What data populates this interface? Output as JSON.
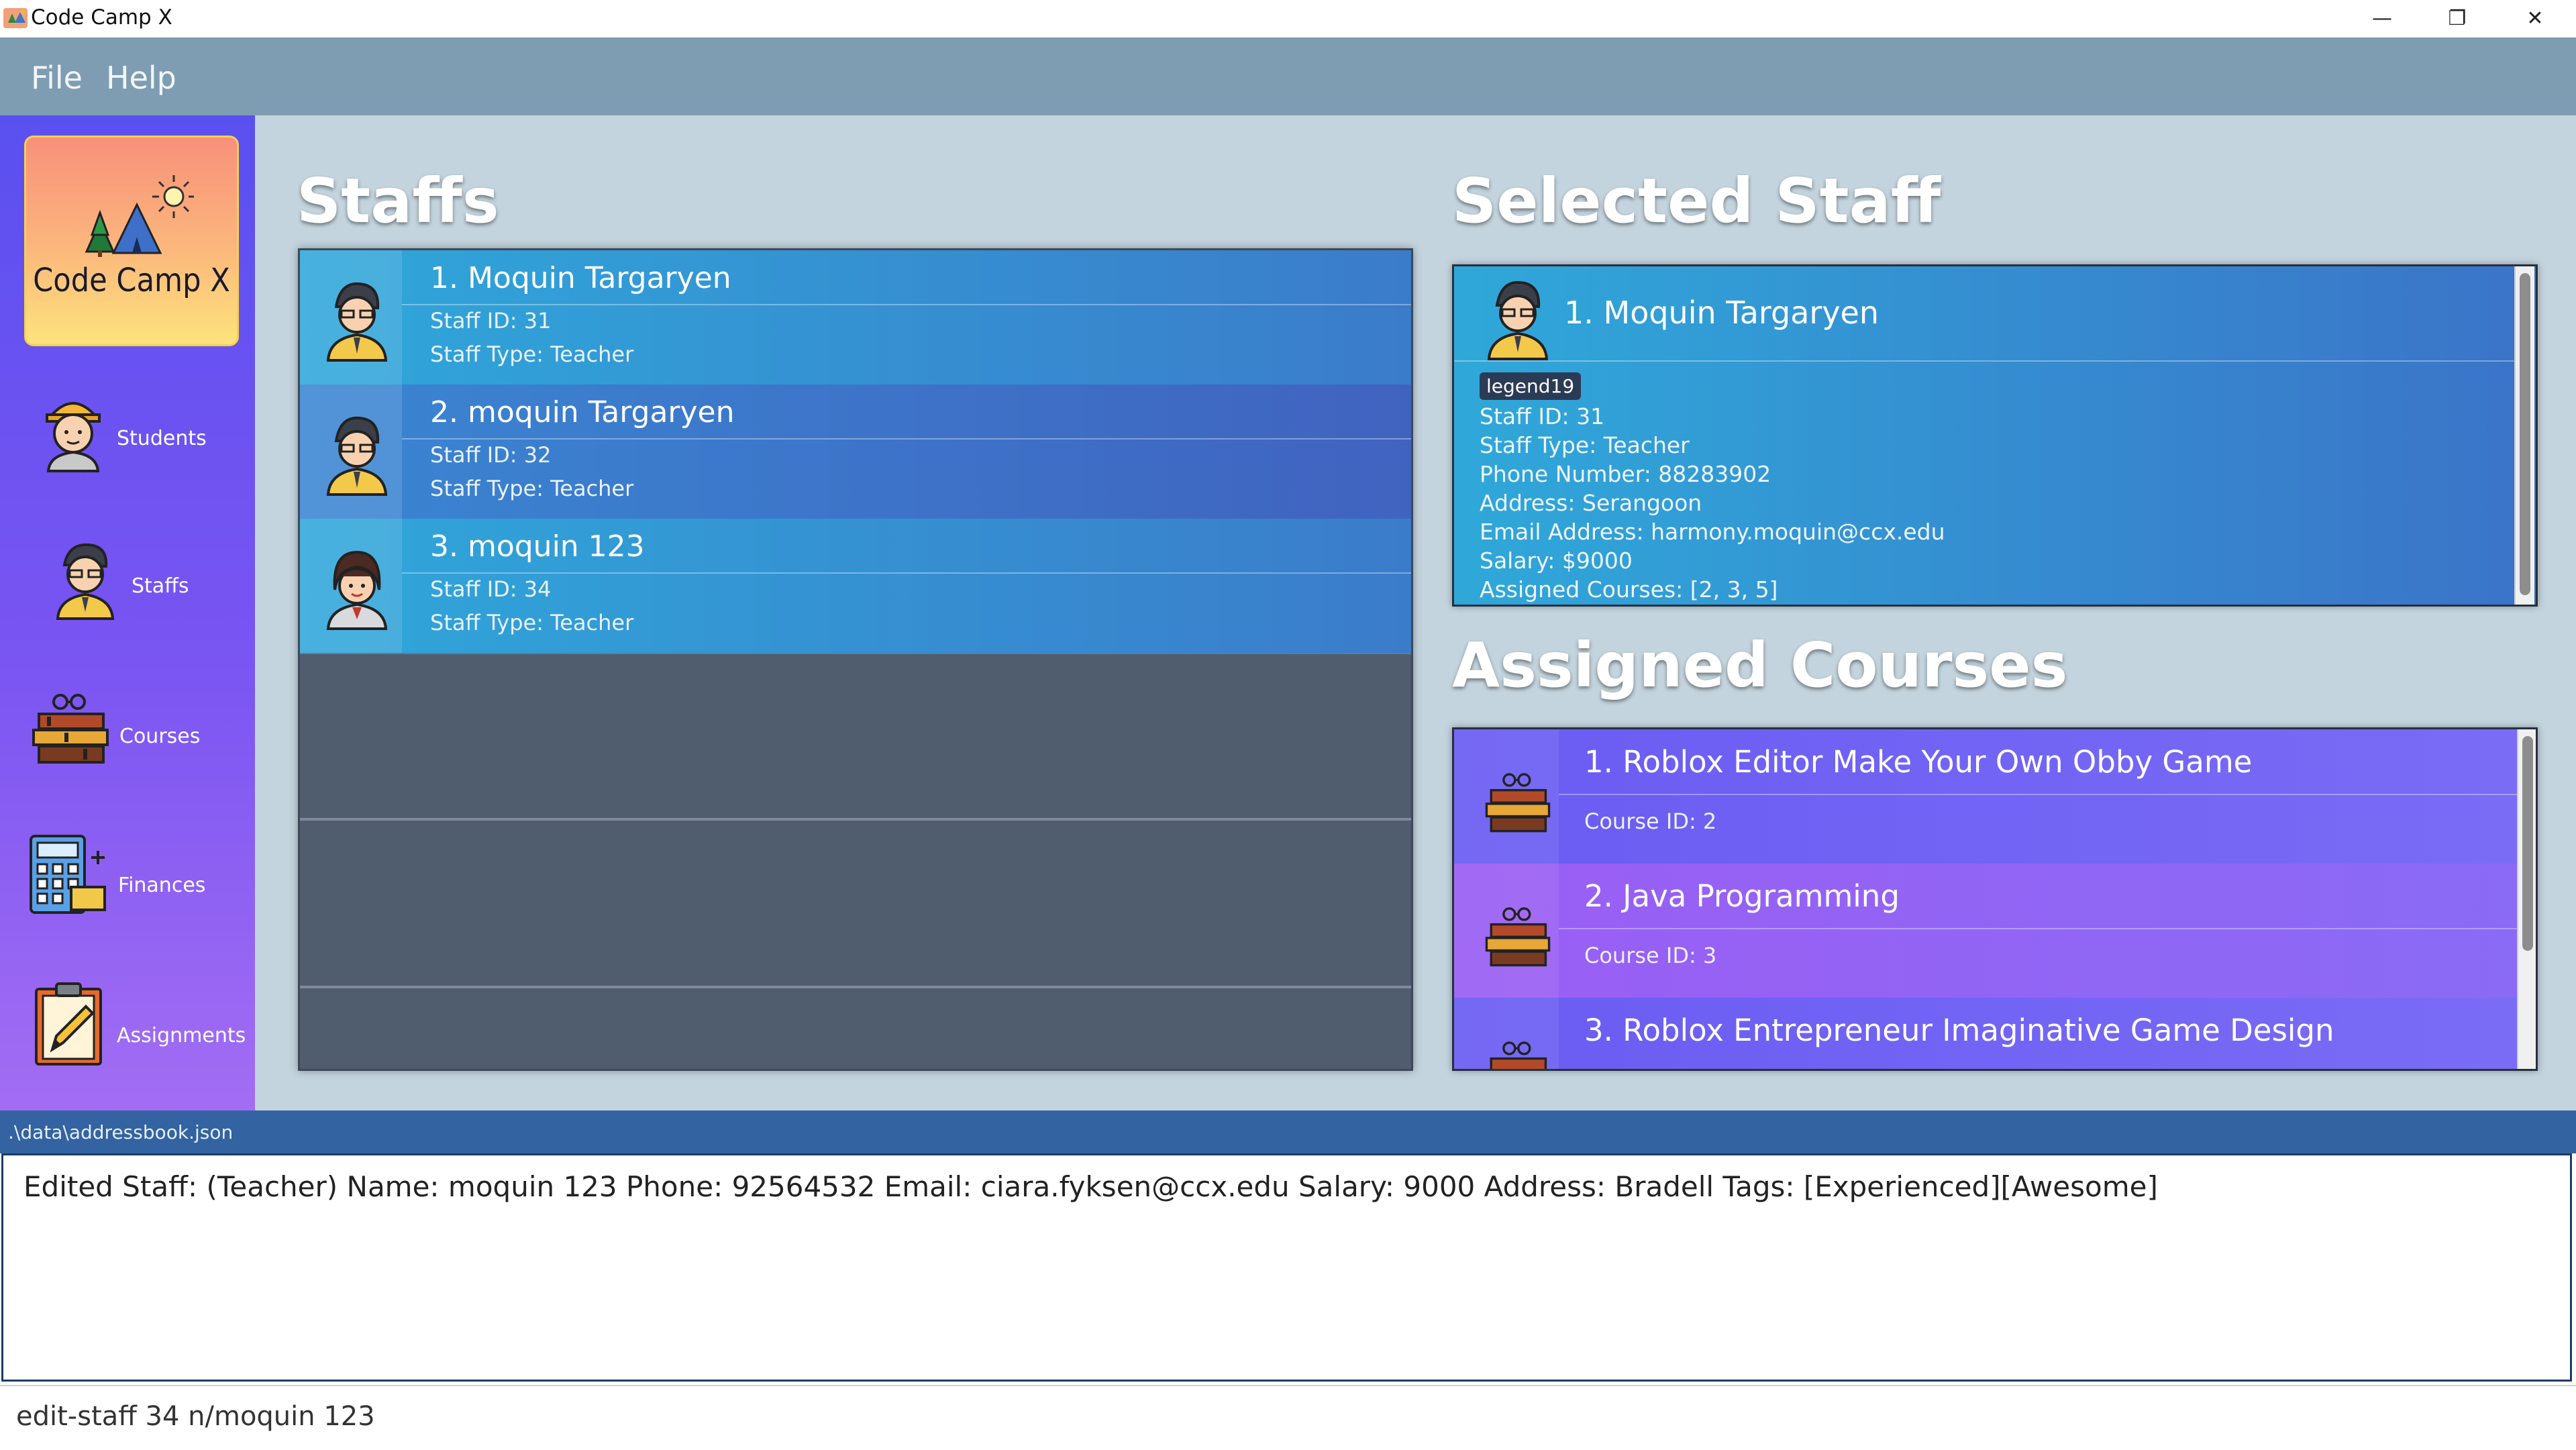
{
  "window": {
    "title": "Code Camp X",
    "controls": [
      "—",
      "❐",
      "✕"
    ]
  },
  "menu": {
    "items": [
      "File",
      "Help"
    ]
  },
  "sidebar": {
    "logo_text": "Code Camp X",
    "items": [
      {
        "label": "Students",
        "icon": "student-icon"
      },
      {
        "label": "Staffs",
        "icon": "staff-icon"
      },
      {
        "label": "Courses",
        "icon": "books-icon"
      },
      {
        "label": "Finances",
        "icon": "calculator-icon"
      },
      {
        "label": "Assignments",
        "icon": "clipboard-pencil-icon"
      }
    ]
  },
  "staffs": {
    "title": "Staffs",
    "items": [
      {
        "name": "1. Moquin Targaryen",
        "id": "Staff ID: 31",
        "type": "Staff Type: Teacher",
        "avatar": "male"
      },
      {
        "name": "2. moquin Targaryen",
        "id": "Staff ID: 32",
        "type": "Staff Type: Teacher",
        "avatar": "male"
      },
      {
        "name": "3. moquin 123",
        "id": "Staff ID: 34",
        "type": "Staff Type: Teacher",
        "avatar": "female"
      }
    ]
  },
  "selected_staff": {
    "title": "Selected Staff",
    "name": "1.  Moquin Targaryen",
    "tag": "legend19",
    "lines": [
      "Staff ID: 31",
      "Staff Type: Teacher",
      "Phone Number: 88283902",
      "Address: Serangoon",
      "Email Address: harmony.moquin@ccx.edu",
      "Salary: $9000",
      "Assigned Courses: [2, 3, 5]"
    ]
  },
  "assigned_courses": {
    "title": "Assigned Courses",
    "items": [
      {
        "name": "1. Roblox Editor Make Your Own Obby Game",
        "id": "Course ID: 2"
      },
      {
        "name": "2. Java Programming",
        "id": "Course ID: 3"
      },
      {
        "name": "3. Roblox Entrepreneur Imaginative Game Design",
        "id": ""
      }
    ]
  },
  "status": {
    "path": ".\\data\\addressbook.json"
  },
  "result": {
    "text": "Edited Staff: (Teacher) Name: moquin 123 Phone: 92564532 Email: ciara.fyksen@ccx.edu Salary: 9000 Address: Bradell Tags: [Experienced][Awesome]"
  },
  "command": {
    "value": "edit-staff 34 n/moquin 123"
  },
  "colors": {
    "menubar": "#7f9db2",
    "sidebar_top": "#5a50f0",
    "sidebar_bottom": "#a36df3",
    "staff_row_a": "#2f9fd8",
    "staff_row_b": "#3f72c9",
    "course_row": "#7b5cf0",
    "statusbar": "#3363a0"
  }
}
